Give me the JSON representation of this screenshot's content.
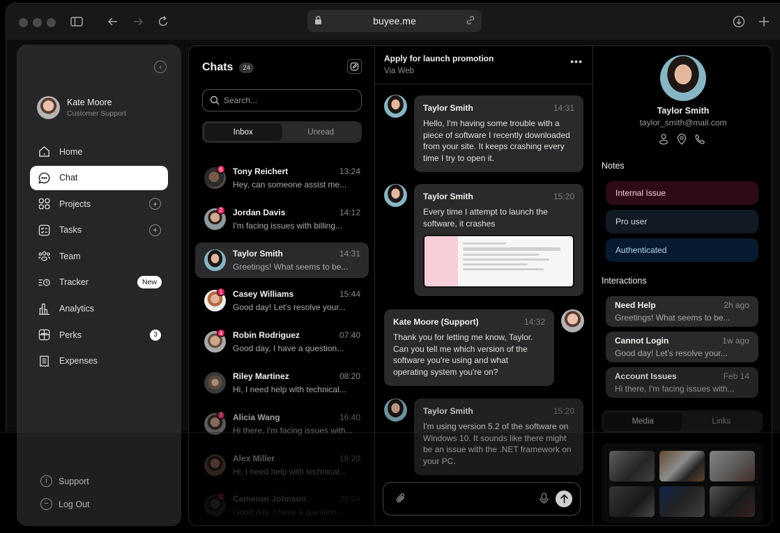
{
  "browser": {
    "url": "buyee.me",
    "icons": [
      "sidebar-toggle-icon",
      "back-arrow-icon",
      "forward-arrow-icon",
      "reload-icon",
      "lock-icon",
      "link-icon",
      "download-icon",
      "plus-icon"
    ]
  },
  "sidebar": {
    "user": {
      "name": "Kate Moore",
      "role": "Customer Support"
    },
    "nav": [
      {
        "label": "Home",
        "icon": "home-icon"
      },
      {
        "label": "Chat",
        "icon": "chat-bubble-icon",
        "active": true
      },
      {
        "label": "Projects",
        "icon": "grid-icon",
        "action": "+"
      },
      {
        "label": "Tasks",
        "icon": "checklist-icon",
        "action": "+"
      },
      {
        "label": "Team",
        "icon": "team-icon"
      },
      {
        "label": "Tracker",
        "icon": "tracker-icon",
        "badge": "New"
      },
      {
        "label": "Analytics",
        "icon": "bar-chart-icon"
      },
      {
        "label": "Perks",
        "icon": "gift-icon",
        "count": "3"
      },
      {
        "label": "Expenses",
        "icon": "receipt-icon"
      }
    ],
    "bottom": [
      {
        "label": "Support",
        "icon": "info-icon",
        "glyph": "i"
      },
      {
        "label": "Log Out",
        "icon": "logout-icon",
        "glyph": "−"
      }
    ]
  },
  "chats": {
    "title": "Chats",
    "count": "24",
    "search_placeholder": "Search...",
    "tabs": [
      {
        "label": "Inbox",
        "active": true
      },
      {
        "label": "Unread"
      }
    ],
    "items": [
      {
        "name": "Tony Reichert",
        "time": "13:24",
        "preview": "Hey, can someone assist me...",
        "unread": "6"
      },
      {
        "name": "Jordan Davis",
        "time": "14:12",
        "preview": "I'm facing issues with billing...",
        "unread": "2"
      },
      {
        "name": "Taylor Smith",
        "time": "14:31",
        "preview": "Greetings! What seems to be...",
        "active": true
      },
      {
        "name": "Casey Williams",
        "time": "15:44",
        "preview": "Good day! Let's resolve your...",
        "unread": "1"
      },
      {
        "name": "Robin Rodriguez",
        "time": "07:40",
        "preview": "Good day, I have a question...",
        "unread": "4"
      },
      {
        "name": "Riley Martinez",
        "time": "08:20",
        "preview": "Hi, I need help with technical..."
      },
      {
        "name": "Alicia Wang",
        "time": "16:40",
        "preview": "Hi there, I'm facing issues with...",
        "unread": "3"
      },
      {
        "name": "Alex Miller",
        "time": "18:20",
        "preview": "Hi, I need help with technical..."
      },
      {
        "name": "Cameron Johnson",
        "time": "20:24",
        "preview": "Good day, I have a question...",
        "unread": "2"
      }
    ]
  },
  "conversation": {
    "title": "Apply for launch promotion",
    "subtitle": "Via Web",
    "more_icon": "more-horizontal-icon",
    "messages": [
      {
        "sender": "Taylor Smith",
        "time": "14:31",
        "text": "Hello, I'm having some trouble with a piece of software I recently downloaded from your site. It keeps crashing every time I try to open it."
      },
      {
        "sender": "Taylor Smith",
        "time": "15:20",
        "text": "Every time I attempt to launch the software, it crashes",
        "attachment": "screenshot-image"
      },
      {
        "sender": "Kate Moore (Support)",
        "time": "14:32",
        "text": "Thank you for letting me know, Taylor. Can you tell me which version of the software you're using and what operating system you're on?",
        "outgoing": true
      },
      {
        "sender": "Taylor Smith",
        "time": "15:20",
        "text": "I'm using version 5.2 of the software on Windows 10. It sounds like there might be an issue with the .NET framework on your PC."
      }
    ],
    "composer": {
      "placeholder": "",
      "icons": [
        "paperclip-icon",
        "microphone-icon",
        "send-arrow-icon"
      ]
    }
  },
  "profile": {
    "name": "Taylor Smith",
    "email": "taylor_smith@mail.com",
    "actions": [
      "user-icon",
      "location-pin-icon",
      "phone-icon"
    ],
    "notes_title": "Notes",
    "notes": [
      {
        "label": "Internal Issue",
        "bg": "#2e0a16",
        "color": "#f0d2d8"
      },
      {
        "label": "Pro user",
        "bg": "#111a24",
        "color": "#d5dbe2"
      },
      {
        "label": "Authenticated",
        "bg": "#071a30",
        "color": "#b8d4ec"
      }
    ],
    "interactions_title": "Interactions",
    "interactions": [
      {
        "title": "Need Help",
        "time": "2h ago",
        "preview": "Greetings! What seems to be..."
      },
      {
        "title": "Cannot Login",
        "time": "1w ago",
        "preview": "Good day! Let's resolve your..."
      },
      {
        "title": "Account Issues",
        "time": "Feb 14",
        "preview": "Hi there, I'm facing issues with..."
      }
    ],
    "media_tabs": [
      {
        "label": "Media",
        "active": true
      },
      {
        "label": "Links"
      }
    ],
    "media_count": 6
  }
}
